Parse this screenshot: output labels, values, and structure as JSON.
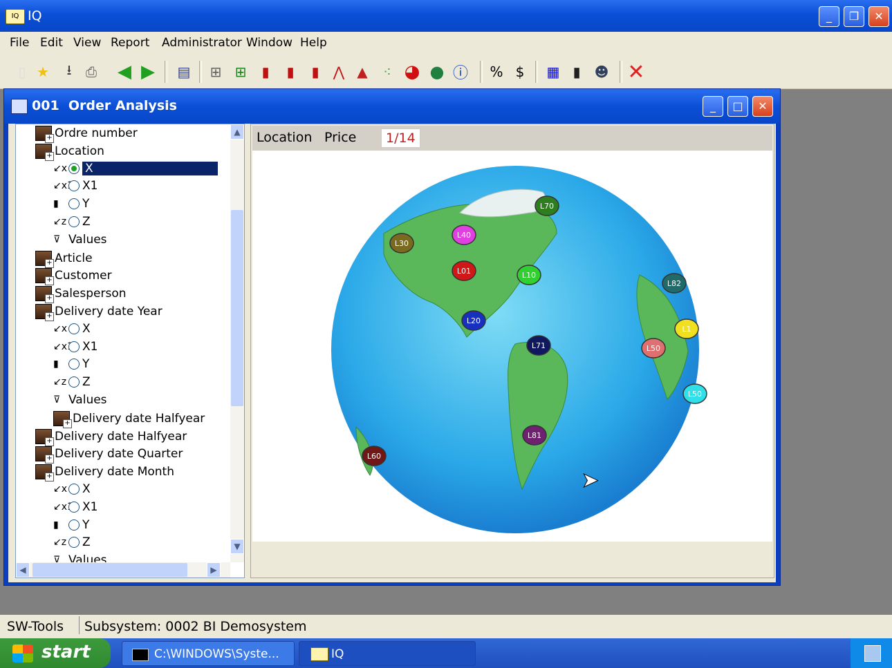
{
  "app": {
    "title": "IQ",
    "icon": "iq-app-icon"
  },
  "menu": [
    "File",
    "Edit",
    "View",
    "Report",
    "Administrator",
    "Window",
    "Help"
  ],
  "toolbar": {
    "percent": "%",
    "currency": "$"
  },
  "window": {
    "title": "001  Order Analysis"
  },
  "tree": {
    "rows": [
      {
        "label": "Ordre number",
        "type": "dim",
        "indent": 0
      },
      {
        "label": "Location",
        "type": "dim",
        "indent": 0
      },
      {
        "label": "X",
        "type": "axis",
        "axis": "x",
        "indent": 1,
        "selected": true
      },
      {
        "label": "X1",
        "type": "axis",
        "axis": "x1",
        "indent": 1
      },
      {
        "label": "Y",
        "type": "axis",
        "axis": "y",
        "indent": 1
      },
      {
        "label": "Z",
        "type": "axis",
        "axis": "z",
        "indent": 1
      },
      {
        "label": "Values",
        "type": "values",
        "indent": 1
      },
      {
        "label": "Article",
        "type": "dim",
        "indent": 0
      },
      {
        "label": "Customer",
        "type": "dim",
        "indent": 0
      },
      {
        "label": "Salesperson",
        "type": "dim",
        "indent": 0
      },
      {
        "label": "Delivery date Year",
        "type": "dim",
        "indent": 0
      },
      {
        "label": "X",
        "type": "axis",
        "axis": "x",
        "indent": 1
      },
      {
        "label": "X1",
        "type": "axis",
        "axis": "x1",
        "indent": 1
      },
      {
        "label": "Y",
        "type": "axis",
        "axis": "y",
        "indent": 1
      },
      {
        "label": "Z",
        "type": "axis",
        "axis": "z",
        "indent": 1
      },
      {
        "label": "Values",
        "type": "values",
        "indent": 1
      },
      {
        "label": "Delivery date Halfyear",
        "type": "dim",
        "indent": 1
      },
      {
        "label": "Delivery date Halfyear",
        "type": "dim",
        "indent": 0
      },
      {
        "label": "Delivery date Quarter",
        "type": "dim",
        "indent": 0
      },
      {
        "label": "Delivery date Month",
        "type": "dim",
        "indent": 0
      },
      {
        "label": "X",
        "type": "axis",
        "axis": "x",
        "indent": 1
      },
      {
        "label": "X1",
        "type": "axis",
        "axis": "x1",
        "indent": 1
      },
      {
        "label": "Y",
        "type": "axis",
        "axis": "y",
        "indent": 1
      },
      {
        "label": "Z",
        "type": "axis",
        "axis": "z",
        "indent": 1
      },
      {
        "label": "Values",
        "type": "values",
        "indent": 1
      }
    ]
  },
  "right": {
    "tab_location": "Location",
    "tab_price": "Price",
    "page": "1/14"
  },
  "globe": {
    "markers": [
      {
        "label": "L70",
        "color": "#2e7d1e"
      },
      {
        "label": "L40",
        "color": "#e040e0"
      },
      {
        "label": "L30",
        "color": "#7a6a20"
      },
      {
        "label": "L01",
        "color": "#d01818"
      },
      {
        "label": "L10",
        "color": "#30d030"
      },
      {
        "label": "L82",
        "color": "#206a6a"
      },
      {
        "label": "L20",
        "color": "#1830c0"
      },
      {
        "label": "L71",
        "color": "#101860"
      },
      {
        "label": "L1",
        "color": "#f0e020"
      },
      {
        "label": "L50",
        "color": "#e07070"
      },
      {
        "label": "L50",
        "color": "#30e0e8"
      },
      {
        "label": "L81",
        "color": "#702070"
      },
      {
        "label": "L60",
        "color": "#701818"
      }
    ]
  },
  "status": {
    "left": "SW-Tools",
    "right": "Subsystem: 0002 BI Demosystem"
  },
  "taskbar": {
    "start": "start",
    "task1": "C:\\WINDOWS\\Syste...",
    "task2": "IQ"
  }
}
